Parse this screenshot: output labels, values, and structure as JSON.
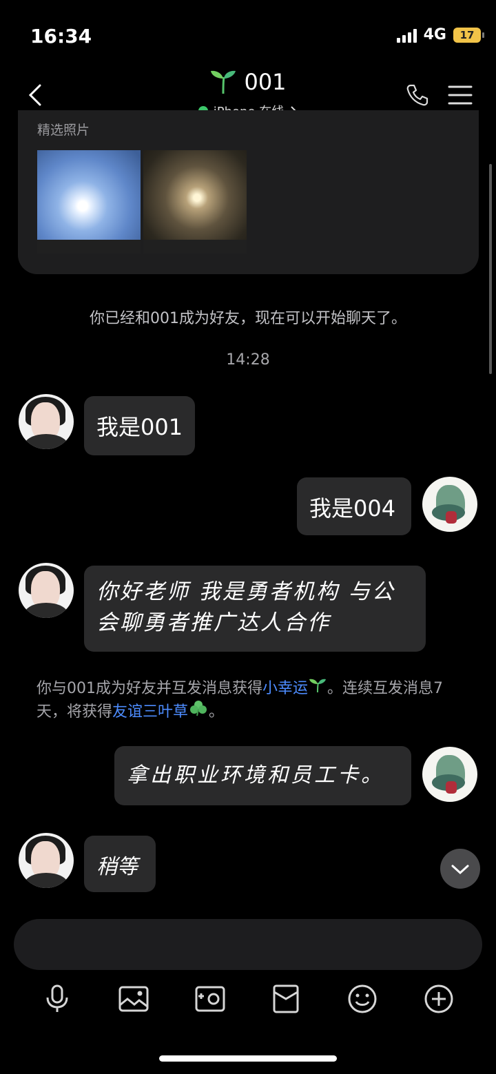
{
  "status_bar": {
    "time": "16:34",
    "network": "4G",
    "battery": "17"
  },
  "header": {
    "title": "001",
    "subtitle": "iPhone 在线",
    "title_icon": "sprout-icon"
  },
  "profile_card": {
    "label": "精选照片"
  },
  "system": {
    "friend_added": "你已经和001成为好友，现在可以开始聊天了。",
    "time_label": "14:28"
  },
  "messages": {
    "m1": "我是001",
    "m2": "我是004",
    "m3": "你好老师 我是勇者机构 与公会聊勇者推广达人合作",
    "m4": "拿出职业环境和员工卡。",
    "m5": "稍等"
  },
  "notice": {
    "text1": "你与001成为好友并互发消息获得",
    "link1": "小幸运",
    "text2": "。连续互发消息7天，将获得",
    "link2": "友谊三叶草",
    "text3": "。"
  },
  "colors": {
    "online": "#3cc76a",
    "link": "#4d8cff",
    "battery": "#f1c348"
  }
}
